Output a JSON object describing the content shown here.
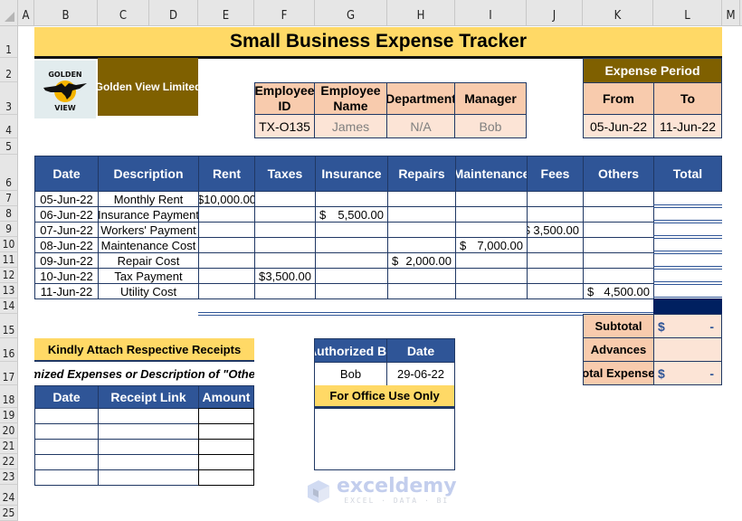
{
  "sheet": {
    "columns": [
      "A",
      "B",
      "C",
      "D",
      "E",
      "F",
      "G",
      "H",
      "I",
      "J",
      "K",
      "L",
      "M"
    ],
    "rows": [
      "1",
      "2",
      "3",
      "4",
      "5",
      "6",
      "7",
      "8",
      "9",
      "10",
      "11",
      "12",
      "13",
      "14",
      "15",
      "16",
      "17",
      "18",
      "19",
      "20",
      "21",
      "22",
      "23",
      "24",
      "25"
    ]
  },
  "header": {
    "title": "Small Business Expense Tracker",
    "company_logo_top": "GOLDEN",
    "company_logo_bottom": "VIEW",
    "company_name": "Golden View Limited"
  },
  "employee": {
    "labels": [
      "Employee ID",
      "Employee Name",
      "Department",
      "Manager"
    ],
    "values": [
      "TX-O135",
      "James",
      "N/A",
      "Bob"
    ]
  },
  "period": {
    "title": "Expense Period",
    "from_label": "From",
    "to_label": "To",
    "from_value": "05-Jun-22",
    "to_value": "11-Jun-22"
  },
  "expenses": {
    "columns": [
      "Date",
      "Description",
      "Rent",
      "Taxes",
      "Insurance",
      "Repairs",
      "Maintenance",
      "Fees",
      "Others",
      "Total"
    ],
    "rows": [
      {
        "date": "05-Jun-22",
        "description": "Monthly Rent",
        "rent": "$10,000.00",
        "taxes": "",
        "insurance": "",
        "repairs": "",
        "maintenance": "",
        "fees": "",
        "others": "",
        "total": ""
      },
      {
        "date": "06-Jun-22",
        "description": "Insurance Payment",
        "rent": "",
        "taxes": "",
        "insurance": "5,500.00",
        "repairs": "",
        "maintenance": "",
        "fees": "",
        "others": "",
        "total": ""
      },
      {
        "date": "07-Jun-22",
        "description": "Workers' Payment",
        "rent": "",
        "taxes": "",
        "insurance": "",
        "repairs": "",
        "maintenance": "",
        "fees": "$ 3,500.00",
        "others": "",
        "total": ""
      },
      {
        "date": "08-Jun-22",
        "description": "Maintenance Cost",
        "rent": "",
        "taxes": "",
        "insurance": "",
        "repairs": "",
        "maintenance": "7,000.00",
        "fees": "",
        "others": "",
        "total": ""
      },
      {
        "date": "09-Jun-22",
        "description": "Repair Cost",
        "rent": "",
        "taxes": "",
        "insurance": "",
        "repairs": "2,000.00",
        "maintenance": "",
        "fees": "",
        "others": "",
        "total": ""
      },
      {
        "date": "10-Jun-22",
        "description": "Tax Payment",
        "rent": "",
        "taxes": "3,500.00",
        "insurance": "",
        "repairs": "",
        "maintenance": "",
        "fees": "",
        "others": "",
        "total": ""
      },
      {
        "date": "11-Jun-22",
        "description": "Utility Cost",
        "rent": "",
        "taxes": "",
        "insurance": "",
        "repairs": "",
        "maintenance": "",
        "fees": "",
        "others": "4,500.00",
        "total": ""
      }
    ],
    "currency_symbol": "$"
  },
  "summary": {
    "subtotal_label": "Subtotal",
    "subtotal_symbol": "$",
    "subtotal_value": "-",
    "advances_label": "Advances",
    "advances_value": "",
    "total_label": "Total Expenses",
    "total_symbol": "$",
    "total_value": "-"
  },
  "receipts": {
    "banner": "Kindly Attach Respective Receipts",
    "subtitle": "Itemized Expenses or Description of \"Others\"",
    "columns": [
      "Date",
      "Receipt Link",
      "Amount"
    ],
    "rows": [
      [
        "",
        "",
        ""
      ],
      [
        "",
        "",
        ""
      ],
      [
        "",
        "",
        ""
      ],
      [
        "",
        "",
        ""
      ],
      [
        "",
        "",
        ""
      ]
    ]
  },
  "authorization": {
    "by_label": "Authorized By",
    "date_label": "Date",
    "by_value": "Bob",
    "date_value": "29-06-22",
    "office_label": "For Office Use Only",
    "office_value": ""
  },
  "watermark": {
    "brand": "exceldemy",
    "tagline": "EXCEL · DATA · BI"
  }
}
